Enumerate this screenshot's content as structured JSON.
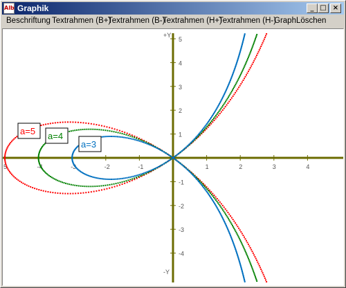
{
  "window": {
    "title": "Graphik",
    "app_icon_text": "Alb"
  },
  "title_buttons": {
    "minimize": "_",
    "maximize": "□",
    "close": "×"
  },
  "menu": [
    "Beschriftung",
    "Textrahmen (B+)",
    "Textrahmen (B-)",
    "Textrahmen (H+)",
    "Textrahmen (H-)",
    "GraphLöschen"
  ],
  "chart_data": {
    "type": "scatter",
    "title": "",
    "ylabel_top": "+Y",
    "ylabel_bottom": "-Y",
    "xlim": [
      -5,
      5
    ],
    "ylim": [
      -5,
      5
    ],
    "x_ticks": [
      "5",
      "-4",
      "-3",
      "-2",
      "-1",
      "1",
      "2",
      "3",
      "4"
    ],
    "y_ticks_pos": [
      "1",
      "2",
      "3",
      "4",
      "5"
    ],
    "y_ticks_neg": [
      "-1",
      "-2",
      "-3",
      "-4"
    ],
    "axis_color": "#6b6b00",
    "series": [
      {
        "name": "a=5",
        "a": 5,
        "color": "#ff0000"
      },
      {
        "name": "a=4",
        "a": 4,
        "color": "#008000"
      },
      {
        "name": "a=3",
        "a": 3,
        "color": "#0070c0"
      }
    ]
  }
}
